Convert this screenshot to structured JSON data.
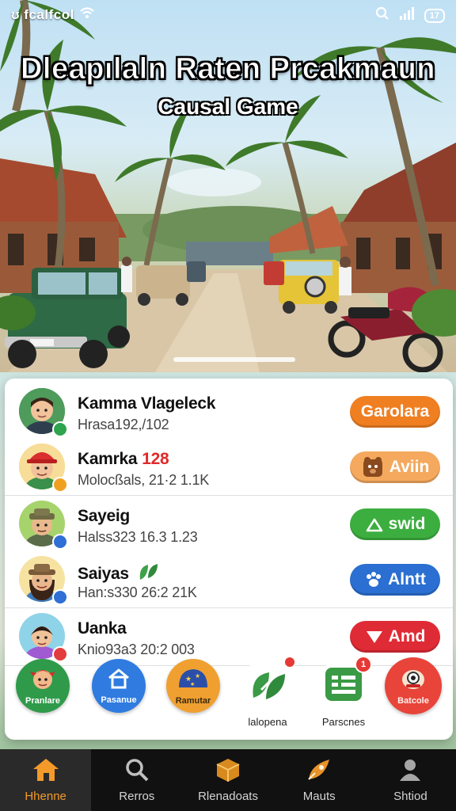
{
  "status_bar": {
    "left_text": "ʊ fcalfcol",
    "battery": "17"
  },
  "hero": {
    "title": "Dleapılaln Raten Prcakmaun",
    "subtitle": "Causal Game"
  },
  "players": [
    {
      "name": "Kamma Vlageleck",
      "extra": "",
      "stat": "Hrasa192,/102",
      "action": "Garolara",
      "action_color": "#f07f21",
      "badge_color": "#2ea44f"
    },
    {
      "name": "Kamrka",
      "extra": "128",
      "stat": "Molocßals, 21·2 1.1K",
      "action": "Aviin",
      "action_color": "#f4a95e",
      "badge_color": "#f0a020"
    },
    {
      "name": "Sayeig",
      "extra": "",
      "stat": "Halss323 16.3 1.23",
      "action": "swid",
      "action_color": "#3cae3f",
      "badge_color": "#2f6fd6"
    },
    {
      "name": "Saiyas",
      "extra": "",
      "stat": "Han:s330 26:2 21K",
      "action": "Alntt",
      "action_color": "#2a6fd1",
      "badge_color": "#2f6fd6"
    },
    {
      "name": "Uanka",
      "extra": "",
      "stat": "Knio93a3 20:2 003",
      "action": "Amd",
      "action_color": "#df2b35",
      "badge_color": "#e33c3c"
    }
  ],
  "categories": [
    {
      "label": "Pranlare",
      "label_inside": true,
      "color": "#2f9a4a",
      "icon": "face-icon"
    },
    {
      "label": "Pasanue",
      "label_inside": true,
      "color": "#2f7be0",
      "icon": "home-icon"
    },
    {
      "label": "Ramutar",
      "label_inside": true,
      "color": "#f0a030",
      "icon": "star-map-icon"
    },
    {
      "label": "lalopena",
      "label_inside": false,
      "color": "#ffffff",
      "icon": "leaf-icon",
      "notification": ""
    },
    {
      "label": "Parscnes",
      "label_inside": false,
      "color": "#ffffff",
      "icon": "list-icon",
      "notification": "1"
    },
    {
      "label": "Batcole",
      "label_inside": true,
      "color": "#e8443a",
      "icon": "creature-icon"
    }
  ],
  "tabs": [
    {
      "label": "Hhenne",
      "icon": "house-icon",
      "active": true
    },
    {
      "label": "Rerros",
      "icon": "search-icon",
      "active": false
    },
    {
      "label": "Rlenadoats",
      "icon": "box-icon",
      "active": false
    },
    {
      "label": "Mauts",
      "icon": "rocket-icon",
      "active": false
    },
    {
      "label": "Shtiod",
      "icon": "person-icon",
      "active": false
    }
  ]
}
